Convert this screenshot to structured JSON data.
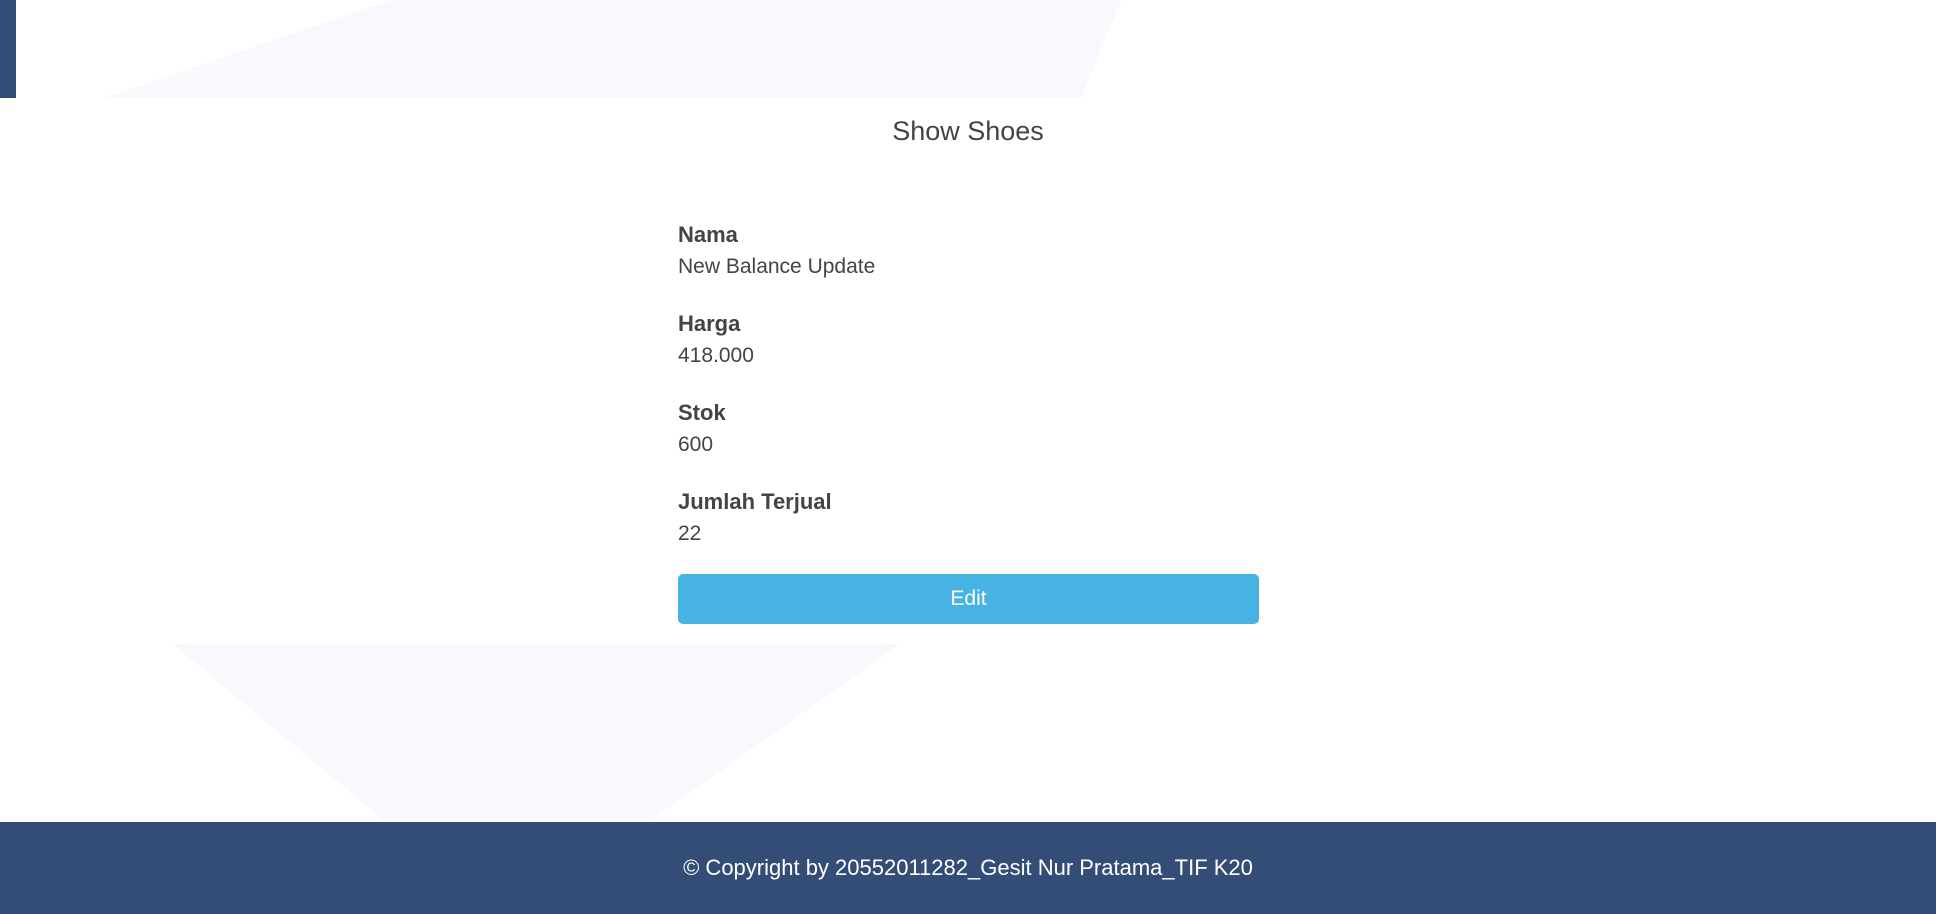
{
  "page": {
    "title": "Show Shoes"
  },
  "fields": [
    {
      "label": "Nama",
      "value": "New Balance Update"
    },
    {
      "label": "Harga",
      "value": "418.000"
    },
    {
      "label": "Stok",
      "value": "600"
    },
    {
      "label": "Jumlah Terjual",
      "value": "22"
    }
  ],
  "actions": {
    "edit_label": "Edit"
  },
  "footer": {
    "copyright": "© Copyright by 20552011282_Gesit Nur Pratama_TIF K20"
  },
  "colors": {
    "brand": "#344d76",
    "button": "#47b2e4",
    "text": "#444444",
    "background_shape": "#f8f8fd"
  }
}
